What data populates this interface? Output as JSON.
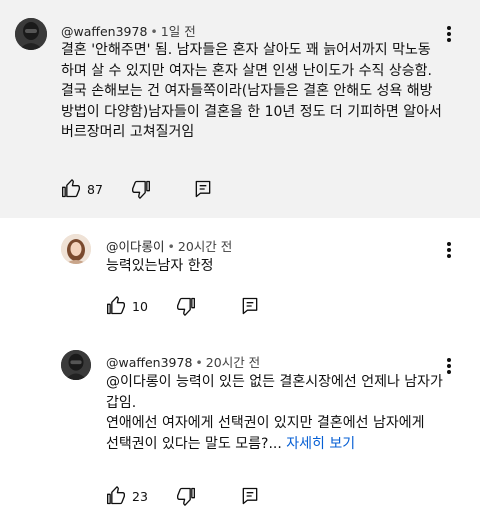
{
  "comments": [
    {
      "handle": "@waffen3978",
      "separator": "•",
      "time": "1일 전",
      "lines": [
        "결혼 '안해주면' 됨. 남자들은 혼자 살아도 꽤 늙어서까지 막노동",
        "하며 살 수 있지만 여자는 혼자 살면 인생 난이도가 수직 상승함.",
        "결국 손해보는 건 여자들쪽이라(남자들은 결혼 안해도 성욕 해방",
        "방법이 다양함)남자들이 결혼을 한 10년 정도 더 기피하면 알아서",
        "버르장머리 고쳐질거임"
      ],
      "likes": "87"
    },
    {
      "handle": "@이다롱이",
      "separator": "•",
      "time": "20시간 전",
      "lines": [
        "능력있는남자 한정"
      ],
      "likes": "10"
    },
    {
      "handle": "@waffen3978",
      "separator": "•",
      "time": "20시간 전",
      "lines": [
        "@이다롱이  능력이 있든 없든 결혼시장에선 언제나 남자가",
        "갑임.",
        "연애에선 여자에게 선택권이 있지만 결혼에선 남자에게",
        "선택권이 있다는 말도 모름?..."
      ],
      "more_label": "자세히 보기",
      "likes": "23"
    }
  ],
  "icons": {
    "like": "thumbs-up-icon",
    "dislike": "thumbs-down-icon",
    "reply": "reply-icon",
    "menu": "more-vertical-icon"
  },
  "colors": {
    "highlight_bg": "#f2f2f2",
    "link": "#065fd4"
  }
}
